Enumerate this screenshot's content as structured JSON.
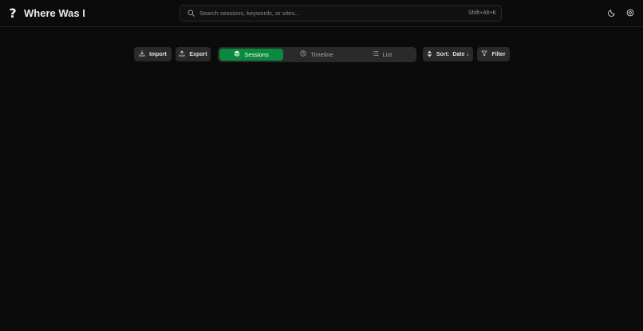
{
  "header": {
    "logo_icon": "question-mark-icon",
    "title": "Where Was I",
    "search": {
      "placeholder": "Search sessions, keywords, or sites...",
      "value": "",
      "shortcut": "Shift+Alt+K"
    },
    "theme_icon": "moon-icon",
    "settings_icon": "gear-icon"
  },
  "toolbar": {
    "import_label": "Import",
    "export_label": "Export",
    "views": [
      {
        "label": "Sessions",
        "icon": "layers-icon",
        "active": true
      },
      {
        "label": "Timeline",
        "icon": "clock-icon",
        "active": false
      },
      {
        "label": "List",
        "icon": "list-icon",
        "active": false
      }
    ],
    "sort_label": "Sort:",
    "sort_value": "Date ↓",
    "filter_label": "Filter"
  },
  "colors": {
    "background": "#0b0b0c",
    "button": "#2a2a2c",
    "accent": "#0a8a3e",
    "text": "#e6e6e6"
  }
}
